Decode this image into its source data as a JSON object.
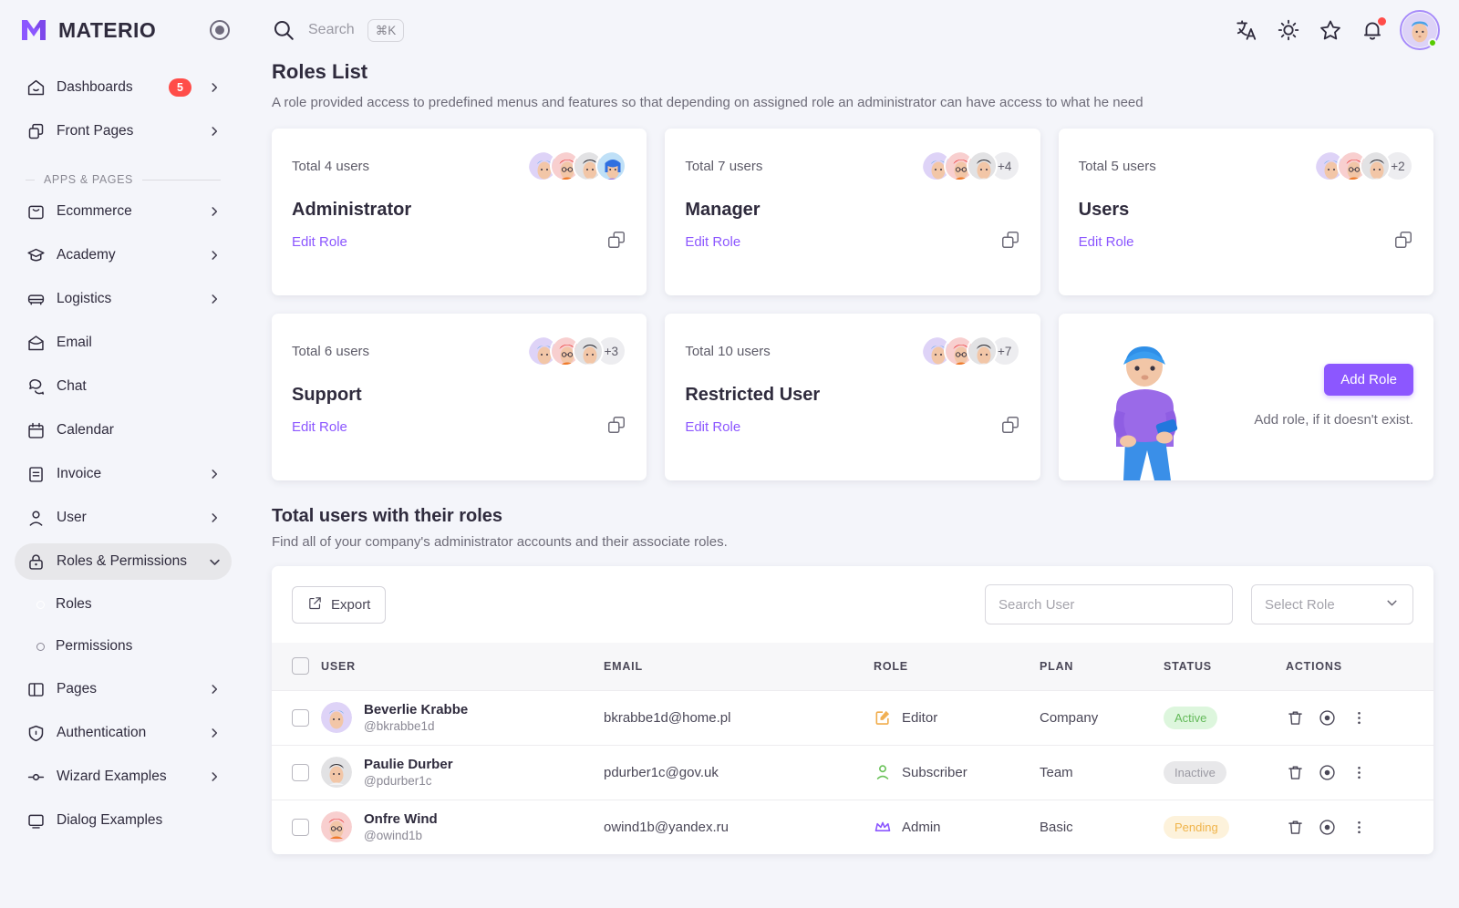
{
  "brand": {
    "name": "MATERIO",
    "logo_icon": "materio-logo-icon",
    "pin_icon": "pin-toggle-icon"
  },
  "sidebar": {
    "top_items": [
      {
        "label": "Dashboards",
        "icon": "home-icon",
        "badge": "5",
        "chevron": true
      },
      {
        "label": "Front Pages",
        "icon": "copy-pages-icon",
        "badge": "",
        "chevron": true
      }
    ],
    "section_label": "APPS & PAGES",
    "items": [
      {
        "label": "Ecommerce",
        "icon": "shopping-bag-icon",
        "chevron": true
      },
      {
        "label": "Academy",
        "icon": "graduation-cap-icon",
        "chevron": true
      },
      {
        "label": "Logistics",
        "icon": "truck-icon",
        "chevron": true
      },
      {
        "label": "Email",
        "icon": "envelope-icon",
        "chevron": false
      },
      {
        "label": "Chat",
        "icon": "chat-bubbles-icon",
        "chevron": false
      },
      {
        "label": "Calendar",
        "icon": "calendar-icon",
        "chevron": false
      },
      {
        "label": "Invoice",
        "icon": "invoice-icon",
        "chevron": true
      },
      {
        "label": "User",
        "icon": "person-icon",
        "chevron": true
      },
      {
        "label": "Roles & Permissions",
        "icon": "lock-icon",
        "chevron": true,
        "state": "open"
      }
    ],
    "sub_items": [
      {
        "label": "Roles",
        "state": "active"
      },
      {
        "label": "Permissions",
        "state": ""
      }
    ],
    "bottom_items": [
      {
        "label": "Pages",
        "icon": "layout-panel-icon",
        "chevron": true
      },
      {
        "label": "Authentication",
        "icon": "shield-icon",
        "chevron": true
      },
      {
        "label": "Wizard Examples",
        "icon": "slider-icon",
        "chevron": true
      },
      {
        "label": "Dialog Examples",
        "icon": "monitor-icon",
        "chevron": false
      }
    ]
  },
  "topbar": {
    "search_icon": "search-icon",
    "search_placeholder": "Search",
    "shortcut": "⌘K",
    "icons": [
      {
        "name": "translate-icon"
      },
      {
        "name": "sun-icon"
      },
      {
        "name": "star-icon"
      },
      {
        "name": "bell-icon",
        "has_dot": true
      }
    ],
    "avatar": "user-avatar"
  },
  "page": {
    "title": "Roles List",
    "subtitle": "A role provided access to predefined menus and features so that depending on assigned role an administrator can have access to what he need"
  },
  "role_cards": [
    {
      "total": "Total 4 users",
      "name": "Administrator",
      "edit": "Edit Role",
      "more": "",
      "avatars": [
        "blue-hair-avatar",
        "red-hair-glasses-avatar",
        "dark-hair-avatar",
        "blue-bob-avatar"
      ],
      "copy_icon": "copy-icon"
    },
    {
      "total": "Total 7 users",
      "name": "Manager",
      "edit": "Edit Role",
      "more": "+4",
      "avatars": [
        "blue-hair-avatar",
        "red-hair-glasses-avatar",
        "dark-hair-avatar"
      ],
      "copy_icon": "copy-icon"
    },
    {
      "total": "Total 5 users",
      "name": "Users",
      "edit": "Edit Role",
      "more": "+2",
      "avatars": [
        "blue-hair-avatar",
        "red-hair-glasses-avatar",
        "dark-hair-avatar"
      ],
      "copy_icon": "copy-icon"
    },
    {
      "total": "Total 6 users",
      "name": "Support",
      "edit": "Edit Role",
      "more": "+3",
      "avatars": [
        "blue-hair-avatar",
        "red-hair-glasses-avatar",
        "dark-hair-avatar"
      ],
      "copy_icon": "copy-icon"
    },
    {
      "total": "Total 10 users",
      "name": "Restricted User",
      "edit": "Edit Role",
      "more": "+7",
      "avatars": [
        "blue-hair-avatar",
        "red-hair-glasses-avatar",
        "dark-hair-avatar"
      ],
      "copy_icon": "copy-icon"
    }
  ],
  "add_role_card": {
    "button_label": "Add Role",
    "text": "Add role, if it doesn't exist.",
    "illustration": "man-with-phone-illustration"
  },
  "users_section": {
    "title": "Total users with their roles",
    "subtitle": "Find all of your company's administrator accounts and their associate roles.",
    "export_label": "Export",
    "export_icon": "external-link-icon",
    "search_placeholder": "Search User",
    "search_value": "",
    "select_role_label": "Select Role",
    "select_chevron_icon": "chevron-down-icon",
    "columns": [
      "USER",
      "EMAIL",
      "ROLE",
      "PLAN",
      "STATUS",
      "ACTIONS"
    ],
    "rows": [
      {
        "name": "Beverlie Krabbe",
        "handle": "@bkrabbe1d",
        "avatar": "blue-hair-avatar",
        "email": "bkrabbe1d@home.pl",
        "role": "Editor",
        "role_icon": "edit-square-icon",
        "role_color": "#f0ac4b",
        "plan": "Company",
        "status": "Active",
        "status_class": "pill-active"
      },
      {
        "name": "Paulie Durber",
        "handle": "@pdurber1c",
        "avatar": "dark-hair-avatar",
        "email": "pdurber1c@gov.uk",
        "role": "Subscriber",
        "role_icon": "person-icon",
        "role_color": "#6ac259",
        "plan": "Team",
        "status": "Inactive",
        "status_class": "pill-inactive"
      },
      {
        "name": "Onfre Wind",
        "handle": "@owind1b",
        "avatar": "red-hair-glasses-avatar",
        "email": "owind1b@yandex.ru",
        "role": "Admin",
        "role_icon": "crown-icon",
        "role_color": "#8c57ff",
        "plan": "Basic",
        "status": "Pending",
        "status_class": "pill-pending"
      }
    ],
    "action_icons": [
      "delete-icon",
      "view-icon",
      "more-vertical-icon"
    ]
  },
  "colors": {
    "primary": "#8c57ff",
    "background": "#f4f5fa",
    "danger": "#ff4d49",
    "success": "#56ca00",
    "warning": "#f0b44b"
  }
}
